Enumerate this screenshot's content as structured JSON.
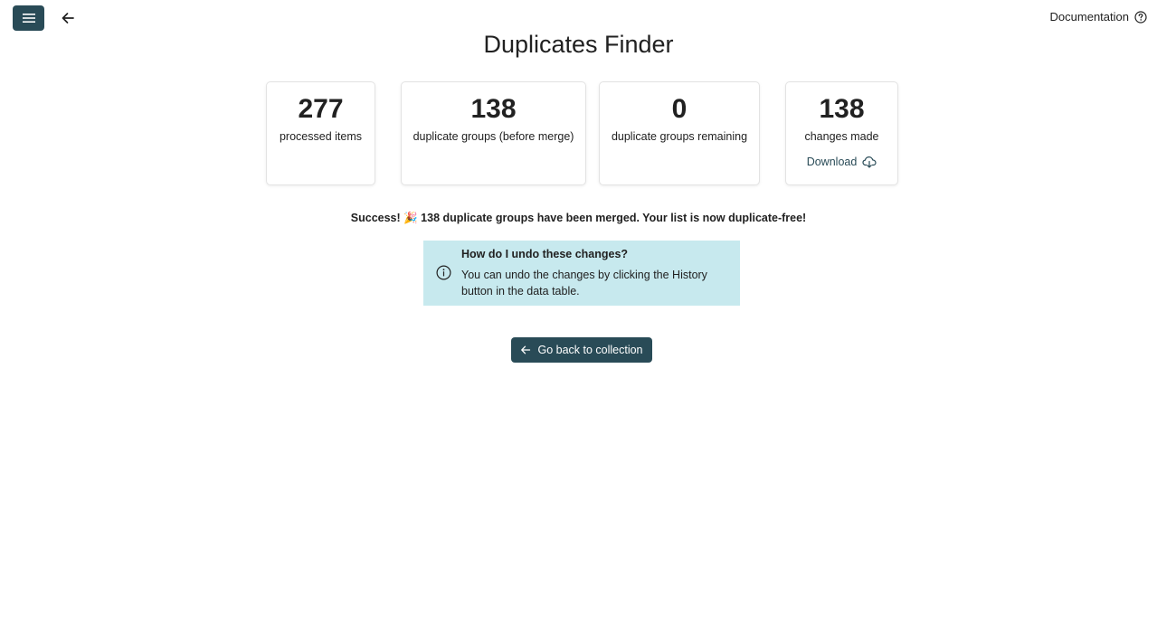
{
  "header": {
    "documentation_label": "Documentation"
  },
  "page": {
    "title": "Duplicates Finder"
  },
  "stats": [
    {
      "value": "277",
      "label": "processed items"
    },
    {
      "value": "138",
      "label": "duplicate groups (before merge)"
    },
    {
      "value": "0",
      "label": "duplicate groups remaining"
    },
    {
      "value": "138",
      "label": "changes made",
      "link": "Download"
    }
  ],
  "success_message": "Success! 🎉 138 duplicate groups have been merged. Your list is now duplicate-free!",
  "info": {
    "title": "How do I undo these changes?",
    "body": "You can undo the changes by clicking the History button in the data table."
  },
  "actions": {
    "go_back_label": "Go back to collection"
  },
  "colors": {
    "primary": "#294b57",
    "info_bg": "#c7e9ee"
  }
}
